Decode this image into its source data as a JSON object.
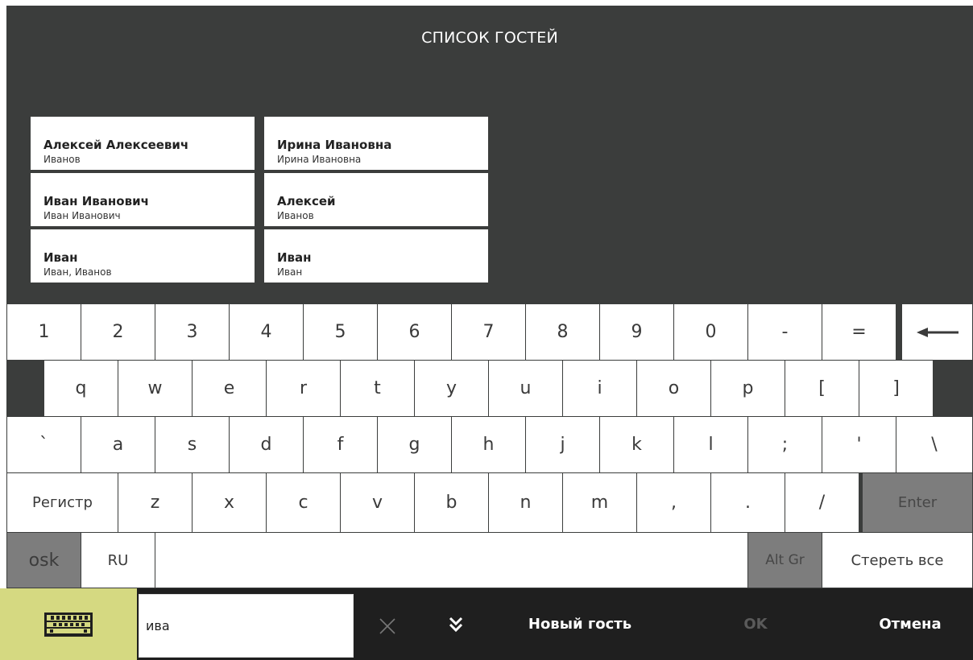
{
  "header": {
    "title": "СПИСОК ГОСТЕЙ"
  },
  "guests": [
    {
      "name": "Алексей Алексеевич",
      "sub": "Иванов"
    },
    {
      "name": "Ирина Ивановна",
      "sub": "Ирина Ивановна"
    },
    {
      "name": "Иван Иванович",
      "sub": "Иван Иванович"
    },
    {
      "name": "Алексей",
      "sub": "Иванов"
    },
    {
      "name": "Иван",
      "sub": "Иван, Иванов"
    },
    {
      "name": "Иван",
      "sub": "Иван"
    }
  ],
  "keyboard": {
    "rows": [
      [
        "1",
        "2",
        "3",
        "4",
        "5",
        "6",
        "7",
        "8",
        "9",
        "0",
        "-",
        "="
      ],
      [
        "q",
        "w",
        "e",
        "r",
        "t",
        "y",
        "u",
        "i",
        "o",
        "p",
        "[",
        "]"
      ],
      [
        "`",
        "a",
        "s",
        "d",
        "f",
        "g",
        "h",
        "j",
        "k",
        "l",
        ";",
        "'",
        "\\"
      ],
      [
        "Регистр",
        "z",
        "x",
        "c",
        "v",
        "b",
        "n",
        "m",
        ",",
        ".",
        "/",
        "Enter"
      ],
      [
        "osk",
        "RU",
        "",
        "Alt Gr",
        "Стереть все"
      ]
    ],
    "backspace_icon": "backspace-arrow-icon"
  },
  "bottom_bar": {
    "keyboard_icon": "keyboard-icon",
    "search_value": "ива",
    "clear_icon": "close-icon",
    "expand_icon": "double-chevron-down-icon",
    "new_guest_label": "Новый гость",
    "ok_label": "OK",
    "cancel_label": "Отмена"
  },
  "colors": {
    "background_dark": "#3b3d3c",
    "key_light": "#ffffff",
    "key_special": "#7d7d7d",
    "bottom_bar": "#1f1f1f",
    "accent_keyboard_toggle": "#d5d981",
    "ok_disabled": "#5a5a5a"
  }
}
